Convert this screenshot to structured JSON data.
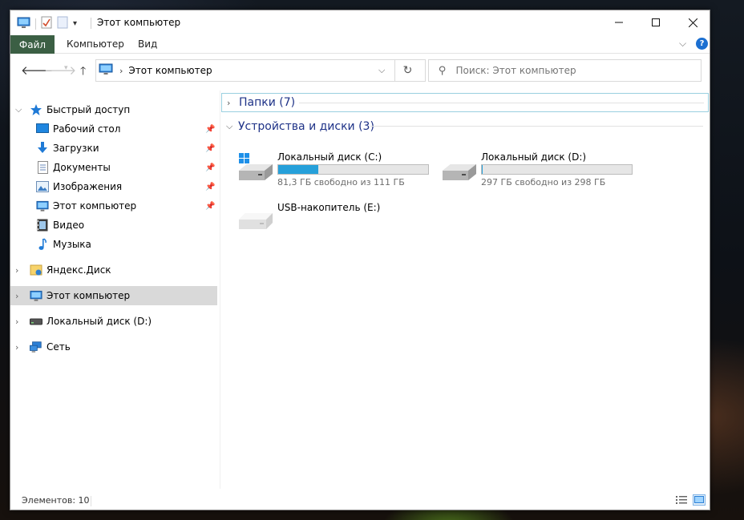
{
  "window": {
    "title": "Этот компьютер"
  },
  "ribbon": {
    "tabs": [
      "Файл",
      "Компьютер",
      "Вид"
    ],
    "help_label": "?"
  },
  "address": {
    "path": "Этот компьютер",
    "search_placeholder": "Поиск: Этот компьютер"
  },
  "sidebar": {
    "quick_access": "Быстрый доступ",
    "quick_items": [
      {
        "label": "Рабочий стол",
        "icon": "desktop-icon",
        "pinned": true
      },
      {
        "label": "Загрузки",
        "icon": "downloads-icon",
        "pinned": true
      },
      {
        "label": "Документы",
        "icon": "documents-icon",
        "pinned": true
      },
      {
        "label": "Изображения",
        "icon": "pictures-icon",
        "pinned": true
      },
      {
        "label": "Этот компьютер",
        "icon": "computer-icon",
        "pinned": true
      },
      {
        "label": "Видео",
        "icon": "video-icon",
        "pinned": false
      },
      {
        "label": "Музыка",
        "icon": "music-icon",
        "pinned": false
      }
    ],
    "roots": [
      {
        "label": "Яндекс.Диск",
        "icon": "yandex-disk-icon"
      },
      {
        "label": "Этот компьютер",
        "icon": "computer-icon",
        "selected": true
      },
      {
        "label": "Локальный диск (D:)",
        "icon": "drive-icon"
      },
      {
        "label": "Сеть",
        "icon": "network-icon"
      }
    ]
  },
  "main": {
    "folders_group": "Папки (7)",
    "devices_group": "Устройства и диски (3)",
    "drives": [
      {
        "name": "Локальный диск (C:)",
        "info": "81,3 ГБ свободно из 111 ГБ",
        "used_fraction": 0.27
      },
      {
        "name": "Локальный диск (D:)",
        "info": "297 ГБ свободно из 298 ГБ",
        "used_fraction": 0.003
      },
      {
        "name": "USB-накопитель (E:)",
        "info": ""
      }
    ]
  },
  "status": {
    "items_count": "Элементов: 10"
  },
  "colors": {
    "file_tab": "#3b5f44",
    "drive_fill": "#26a0da",
    "group_title": "#1e3287",
    "selected_row": "#d9d9d9"
  }
}
